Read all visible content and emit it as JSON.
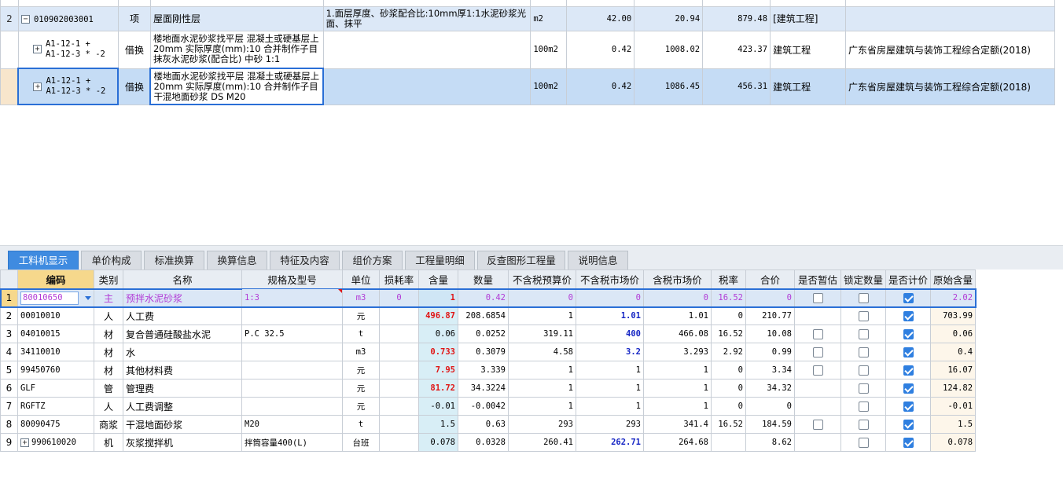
{
  "top_grid": {
    "rows": [
      {
        "no": "2",
        "expand": "−",
        "code": "010902003001",
        "type": "项",
        "name": "屋面刚性层",
        "feature": "1.面层厚度、砂浆配合比:10mm厚1:1水泥砂浆光面、抹平",
        "unit": "m2",
        "qty": "42.00",
        "price": "20.94",
        "total": "879.48",
        "category": "[建筑工程]",
        "standard": ""
      },
      {
        "no": "",
        "expand": "+",
        "code_line1": "A1-12-1 +",
        "code_line2": "A1-12-3 * -2",
        "type": "借换",
        "name": "楼地面水泥砂浆找平层 混凝土或硬基层上 20mm  实际厚度(mm):10  合并制作子目 抹灰水泥砂浆(配合比) 中砂 1:1",
        "feature": "",
        "unit": "100m2",
        "qty": "0.42",
        "price": "1008.02",
        "total": "423.37",
        "category": "建筑工程",
        "standard": "广东省房屋建筑与装饰工程综合定额(2018)"
      },
      {
        "no": "",
        "expand": "+",
        "code_line1": "A1-12-1 +",
        "code_line2": "A1-12-3 * -2",
        "type": "借换",
        "name": "楼地面水泥砂浆找平层 混凝土或硬基层上 20mm  实际厚度(mm):10  合并制作子目 干混地面砂浆 DS M20",
        "feature": "",
        "unit": "100m2",
        "qty": "0.42",
        "price": "1086.45",
        "total": "456.31",
        "category": "建筑工程",
        "standard": "广东省房屋建筑与装饰工程综合定额(2018)"
      }
    ]
  },
  "tabs": [
    {
      "label": "工料机显示",
      "active": true
    },
    {
      "label": "单价构成",
      "active": false
    },
    {
      "label": "标准换算",
      "active": false
    },
    {
      "label": "换算信息",
      "active": false
    },
    {
      "label": "特征及内容",
      "active": false
    },
    {
      "label": "组价方案",
      "active": false
    },
    {
      "label": "工程量明细",
      "active": false
    },
    {
      "label": "反查图形工程量",
      "active": false
    },
    {
      "label": "说明信息",
      "active": false
    }
  ],
  "bottom_grid": {
    "columns": [
      "编码",
      "类别",
      "名称",
      "规格及型号",
      "单位",
      "损耗率",
      "含量",
      "数量",
      "不含税预算价",
      "不含税市场价",
      "含税市场价",
      "税率",
      "合价",
      "是否暂估",
      "锁定数量",
      "是否计价",
      "原始含量"
    ],
    "rows": [
      {
        "no": "1",
        "code": "80010650",
        "cat": "主",
        "name": "预拌水泥砂浆",
        "spec": "1:3",
        "unit": "m3",
        "loss": "0",
        "content": "1",
        "qty": "0.42",
        "budget": "0",
        "market": "0",
        "market_tax": "0",
        "tax": "16.52",
        "total": "0",
        "provisional": false,
        "locked": false,
        "priced": true,
        "orig": "2.02"
      },
      {
        "no": "2",
        "code": "00010010",
        "cat": "人",
        "name": "人工费",
        "spec": "",
        "unit": "元",
        "loss": "",
        "content": "496.87",
        "qty": "208.6854",
        "budget": "1",
        "market": "1.01",
        "market_tax": "1.01",
        "tax": "0",
        "total": "210.77",
        "provisional": null,
        "locked": false,
        "priced": true,
        "orig": "703.99"
      },
      {
        "no": "3",
        "code": "04010015",
        "cat": "材",
        "name": "复合普通硅酸盐水泥",
        "spec": "P.C 32.5",
        "unit": "t",
        "loss": "",
        "content": "0.06",
        "qty": "0.0252",
        "budget": "319.11",
        "market": "400",
        "market_tax": "466.08",
        "tax": "16.52",
        "total": "10.08",
        "provisional": false,
        "locked": false,
        "priced": true,
        "orig": "0.06"
      },
      {
        "no": "4",
        "code": "34110010",
        "cat": "材",
        "name": "水",
        "spec": "",
        "unit": "m3",
        "loss": "",
        "content": "0.733",
        "qty": "0.3079",
        "budget": "4.58",
        "market": "3.2",
        "market_tax": "3.293",
        "tax": "2.92",
        "total": "0.99",
        "provisional": false,
        "locked": false,
        "priced": true,
        "orig": "0.4"
      },
      {
        "no": "5",
        "code": "99450760",
        "cat": "材",
        "name": "其他材料费",
        "spec": "",
        "unit": "元",
        "loss": "",
        "content": "7.95",
        "qty": "3.339",
        "budget": "1",
        "market": "1",
        "market_tax": "1",
        "tax": "0",
        "total": "3.34",
        "provisional": false,
        "locked": false,
        "priced": true,
        "orig": "16.07"
      },
      {
        "no": "6",
        "code": "GLF",
        "cat": "管",
        "name": "管理费",
        "spec": "",
        "unit": "元",
        "loss": "",
        "content": "81.72",
        "qty": "34.3224",
        "budget": "1",
        "market": "1",
        "market_tax": "1",
        "tax": "0",
        "total": "34.32",
        "provisional": null,
        "locked": false,
        "priced": true,
        "orig": "124.82"
      },
      {
        "no": "7",
        "code": "RGFTZ",
        "cat": "人",
        "name": "人工费调整",
        "spec": "",
        "unit": "元",
        "loss": "",
        "content": "-0.01",
        "qty": "-0.0042",
        "budget": "1",
        "market": "1",
        "market_tax": "1",
        "tax": "0",
        "total": "0",
        "provisional": null,
        "locked": false,
        "priced": true,
        "orig": "-0.01"
      },
      {
        "no": "8",
        "code": "80090475",
        "cat": "商浆",
        "name": "干混地面砂浆",
        "spec": "M20",
        "unit": "t",
        "loss": "",
        "content": "1.5",
        "qty": "0.63",
        "budget": "293",
        "market": "293",
        "market_tax": "341.4",
        "tax": "16.52",
        "total": "184.59",
        "provisional": false,
        "locked": false,
        "priced": true,
        "orig": "1.5"
      },
      {
        "no": "9",
        "code": "990610020",
        "expand": "+",
        "cat": "机",
        "name": "灰浆搅拌机",
        "spec": "拌筒容量400(L)",
        "unit": "台班",
        "loss": "",
        "content": "0.078",
        "qty": "0.0328",
        "budget": "260.41",
        "market": "262.71",
        "market_tax": "264.68",
        "tax": "",
        "total": "8.62",
        "provisional": null,
        "locked": false,
        "priced": true,
        "orig": "0.078"
      }
    ],
    "highlight_red_content_rows": [
      1,
      3,
      4,
      5
    ],
    "highlight_blue_market_rows": [
      1,
      2,
      3,
      8
    ]
  }
}
